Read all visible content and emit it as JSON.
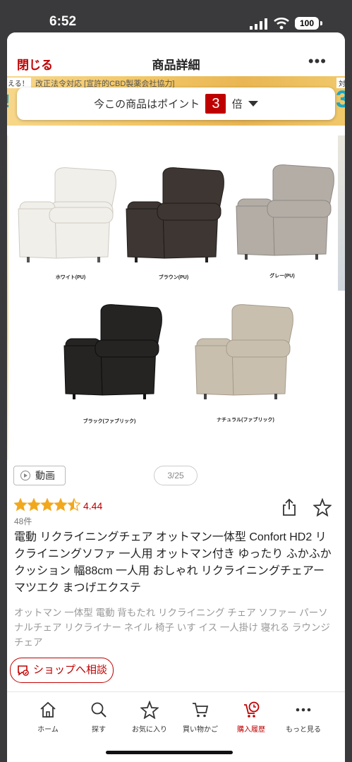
{
  "status": {
    "time": "6:52",
    "battery": "100"
  },
  "header": {
    "close_label": "閉じる",
    "title": "商品詳細",
    "more_label": "•••"
  },
  "banner": {
    "text": "改正法令対応 [宣許的CBD製薬会社協力]",
    "left_text": "える！",
    "right_text": "対"
  },
  "points": {
    "prefix": "今この商品はポイント",
    "multiplier": "3",
    "suffix": "倍"
  },
  "gallery": {
    "chairs": [
      {
        "label": "ホワイト(PU)",
        "color": "#f1efea"
      },
      {
        "label": "ブラウン(PU)",
        "color": "#3e3632"
      },
      {
        "label": "グレー(PU)",
        "color": "#b3ada6"
      },
      {
        "label": "ブラック(ファブリック)",
        "color": "#252423"
      },
      {
        "label": "ナチュラル(ファブリック)",
        "color": "#c9bfaf"
      }
    ]
  },
  "media": {
    "video_label": "動画",
    "page_indicator": "3/25"
  },
  "rating": {
    "value": "4.44",
    "stars": 4.5,
    "review_count": "48件"
  },
  "product": {
    "title": "電動 リクライニングチェア オットマン一体型 Confort HD2 リクライニングソファ 一人用 オットマン付き ゆったり ふかふか クッション 幅88cm 一人用 おしゃれ リクライニングチェアー マツエク まつげエクステ",
    "tags": "オットマン 一体型 電動 背もたれ リクライニング チェア ソファー パーソナルチェア リクライナー ネイル 椅子 いす イス 一人掛け 寝れる ラウンジチェア"
  },
  "consult": {
    "label": "ショップへ相談"
  },
  "tabbar": {
    "items": [
      {
        "label": "ホーム",
        "icon": "home-icon"
      },
      {
        "label": "探す",
        "icon": "search-icon"
      },
      {
        "label": "お気に入り",
        "icon": "star-icon"
      },
      {
        "label": "買い物かご",
        "icon": "cart-icon"
      },
      {
        "label": "購入履歴",
        "icon": "history-icon",
        "active": true
      },
      {
        "label": "もっと見る",
        "icon": "more-icon"
      }
    ]
  },
  "colors": {
    "accent": "#bf0000",
    "star": "#f2a81d"
  }
}
